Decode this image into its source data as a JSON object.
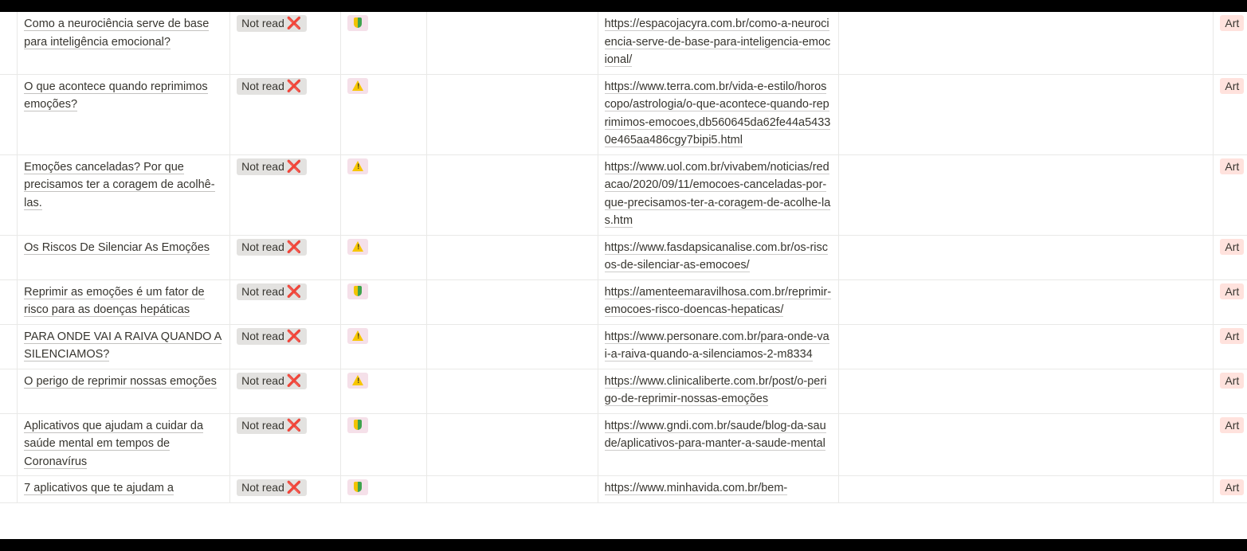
{
  "table": {
    "rows": [
      {
        "title": "Como a neurociência serve de base para inteligência emocional?",
        "status": "Not read",
        "reliability": "shield-icon",
        "url": "https://espacojacyra.com.br/como-a-neurociencia-serve-de-base-para-inteligencia-emocional/",
        "type": "Art"
      },
      {
        "title": "O que acontece quando reprimimos emoções?",
        "status": "Not read",
        "reliability": "warning-icon",
        "url": "https://www.terra.com.br/vida-e-estilo/horoscopo/astrologia/o-que-acontece-quando-reprimimos-emocoes,db560645da62fe44a54330e465aa486cgy7bipi5.html",
        "type": "Art"
      },
      {
        "title": "Emoções canceladas? Por que precisamos ter a coragem de acolhê-las.",
        "status": "Not read",
        "reliability": "warning-icon",
        "url": "https://www.uol.com.br/vivabem/noticias/redacao/2020/09/11/emocoes-canceladas-por-que-precisamos-ter-a-coragem-de-acolhe-las.htm",
        "type": "Art"
      },
      {
        "title": "Os Riscos De Silenciar As Emoções",
        "status": "Not read",
        "reliability": "warning-icon",
        "url": "https://www.fasdapsicanalise.com.br/os-riscos-de-silenciar-as-emocoes/",
        "type": "Art"
      },
      {
        "title": "Reprimir as emoções é um fator de risco para as doenças hepáticas",
        "status": "Not read",
        "reliability": "shield-icon",
        "url": "https://amenteemaravilhosa.com.br/reprimir-emocoes-risco-doencas-hepaticas/",
        "type": "Art"
      },
      {
        "title": "PARA ONDE VAI A RAIVA QUANDO A SILENCIAMOS?",
        "status": "Not read",
        "reliability": "warning-icon",
        "url": "https://www.personare.com.br/para-onde-vai-a-raiva-quando-a-silenciamos-2-m8334",
        "type": "Art"
      },
      {
        "title": "O perigo de reprimir nossas emoções",
        "status": "Not read",
        "reliability": "warning-icon",
        "url": "https://www.clinicaliberte.com.br/post/o-perigo-de-reprimir-nossas-emoções",
        "type": "Art"
      },
      {
        "title": "Aplicativos que ajudam a cuidar da saúde mental em tempos de Coronavírus",
        "status": "Not read",
        "reliability": "shield-icon",
        "url": "https://www.gndi.com.br/saude/blog-da-saude/aplicativos-para-manter-a-saude-mental",
        "type": "Art"
      },
      {
        "title": "7 aplicativos que te ajudam a",
        "status": "Not read",
        "reliability": "shield-icon",
        "url": "https://www.minhavida.com.br/bem-",
        "type": "Art"
      }
    ]
  },
  "icons": {
    "not_read_mark": "❌"
  },
  "colors": {
    "status_bg": "#e3e2e0",
    "icon_bg": "#f5e0e9",
    "type_bg": "#ffe2dd",
    "x_mark": "#e03e3e"
  }
}
